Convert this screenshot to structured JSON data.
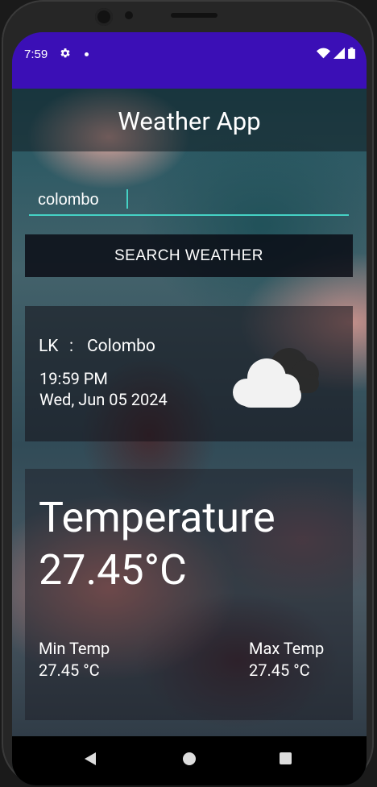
{
  "status_bar": {
    "time": "7:59",
    "icons": [
      "gear-icon",
      "notification-dot-icon",
      "wifi-icon",
      "signal-icon",
      "battery-icon"
    ]
  },
  "app": {
    "title": "Weather App"
  },
  "search": {
    "value": "colombo",
    "button_label": "SEARCH WEATHER"
  },
  "location": {
    "country": "LK",
    "separator": ":",
    "city": "Colombo",
    "time": "19:59 PM",
    "date": "Wed, Jun 05 2024",
    "icon": "cloud-icon"
  },
  "temperature": {
    "label": "Temperature",
    "value": "27.45°C",
    "min_label": "Min Temp",
    "min_value": "27.45 °C",
    "max_label": "Max Temp",
    "max_value": "27.45 °C"
  },
  "nav": {
    "icons": [
      "back-icon",
      "home-icon",
      "recents-icon"
    ]
  },
  "colors": {
    "status_bar": "#3b0fb6",
    "accent": "#45d2c5",
    "button_background": "#08070f"
  }
}
